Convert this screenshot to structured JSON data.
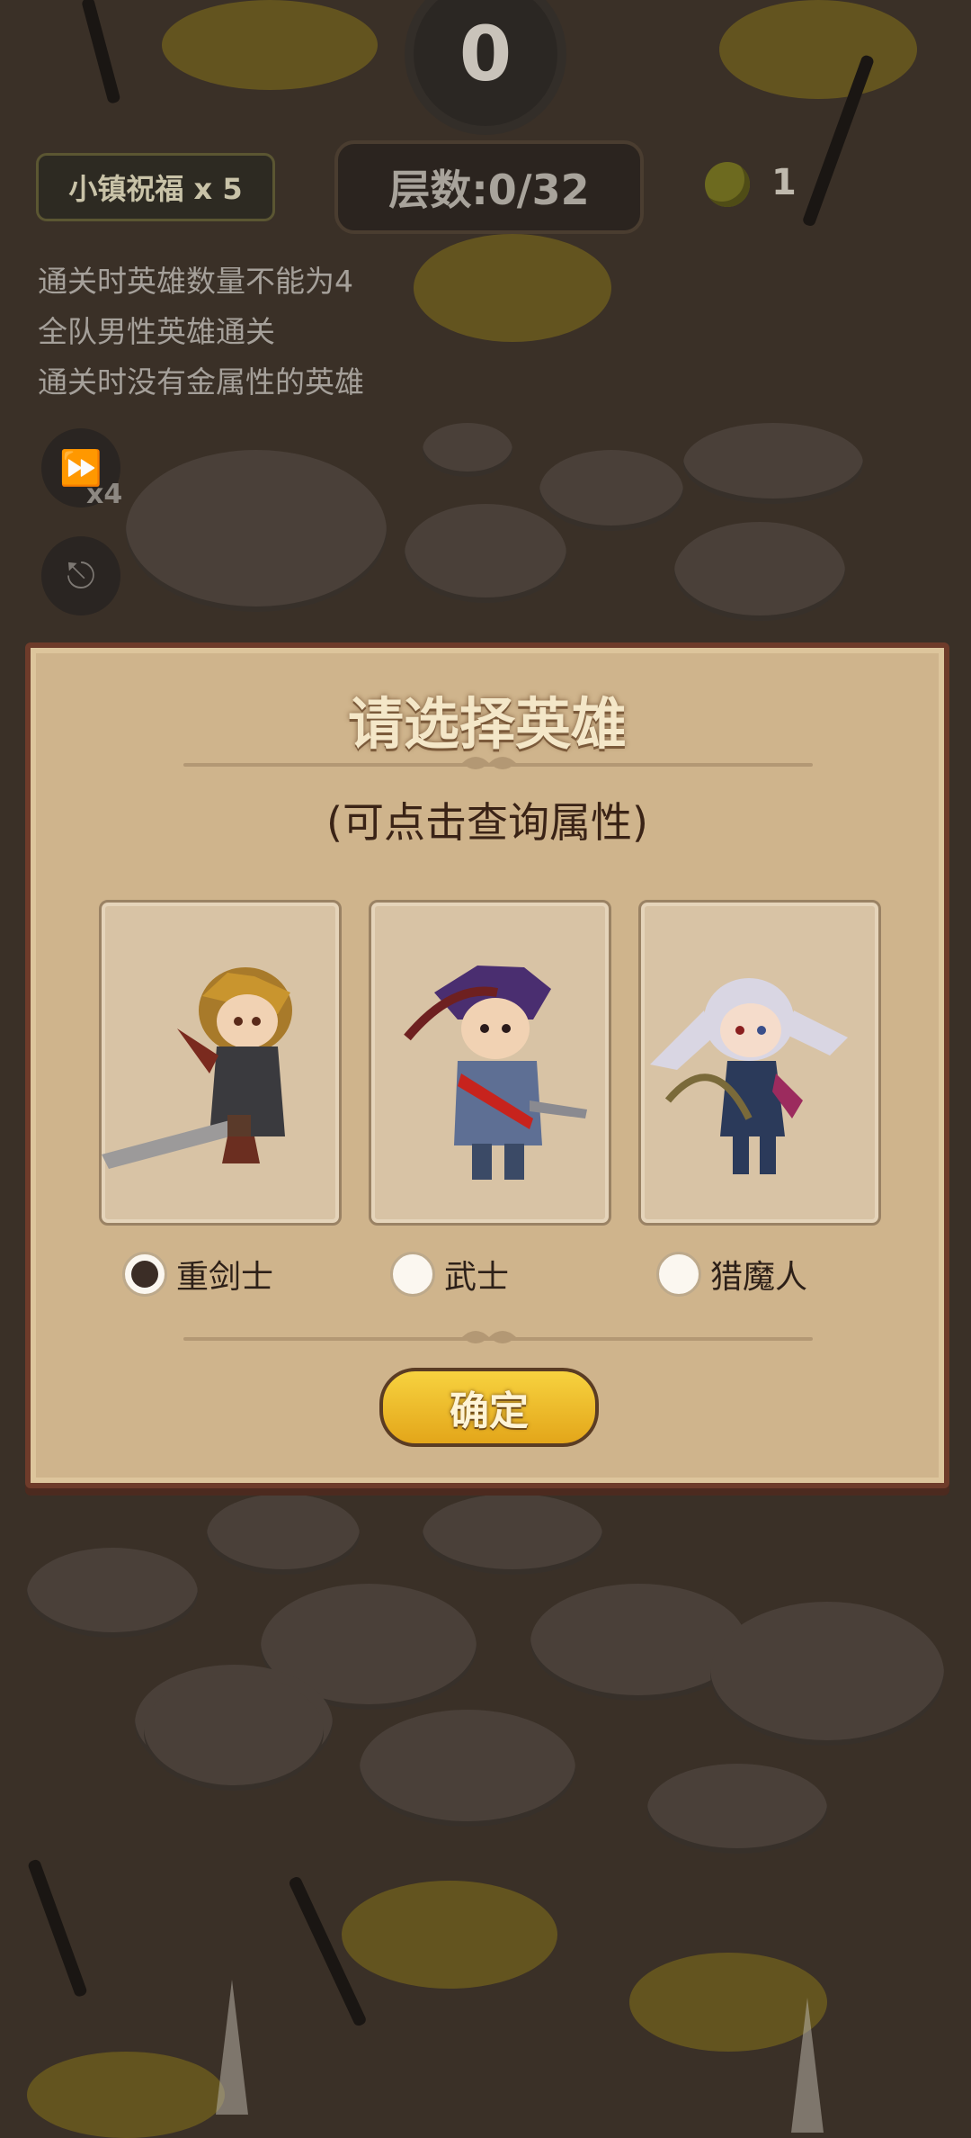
{
  "hud": {
    "wave_number": "0",
    "blessing": "小镇祝福 x 5",
    "floor": "层数:0/32",
    "coins": "1",
    "speed": "x4"
  },
  "tasks": [
    "通关时英雄数量不能为4",
    "全队男性英雄通关",
    "通关时没有金属性的英雄"
  ],
  "dialog": {
    "title": "请选择英雄",
    "subtitle": "(可点击查询属性)",
    "options": [
      {
        "label": "重剑士",
        "selected": true
      },
      {
        "label": "武士",
        "selected": false
      },
      {
        "label": "猎魔人",
        "selected": false
      }
    ],
    "confirm": "确定"
  }
}
